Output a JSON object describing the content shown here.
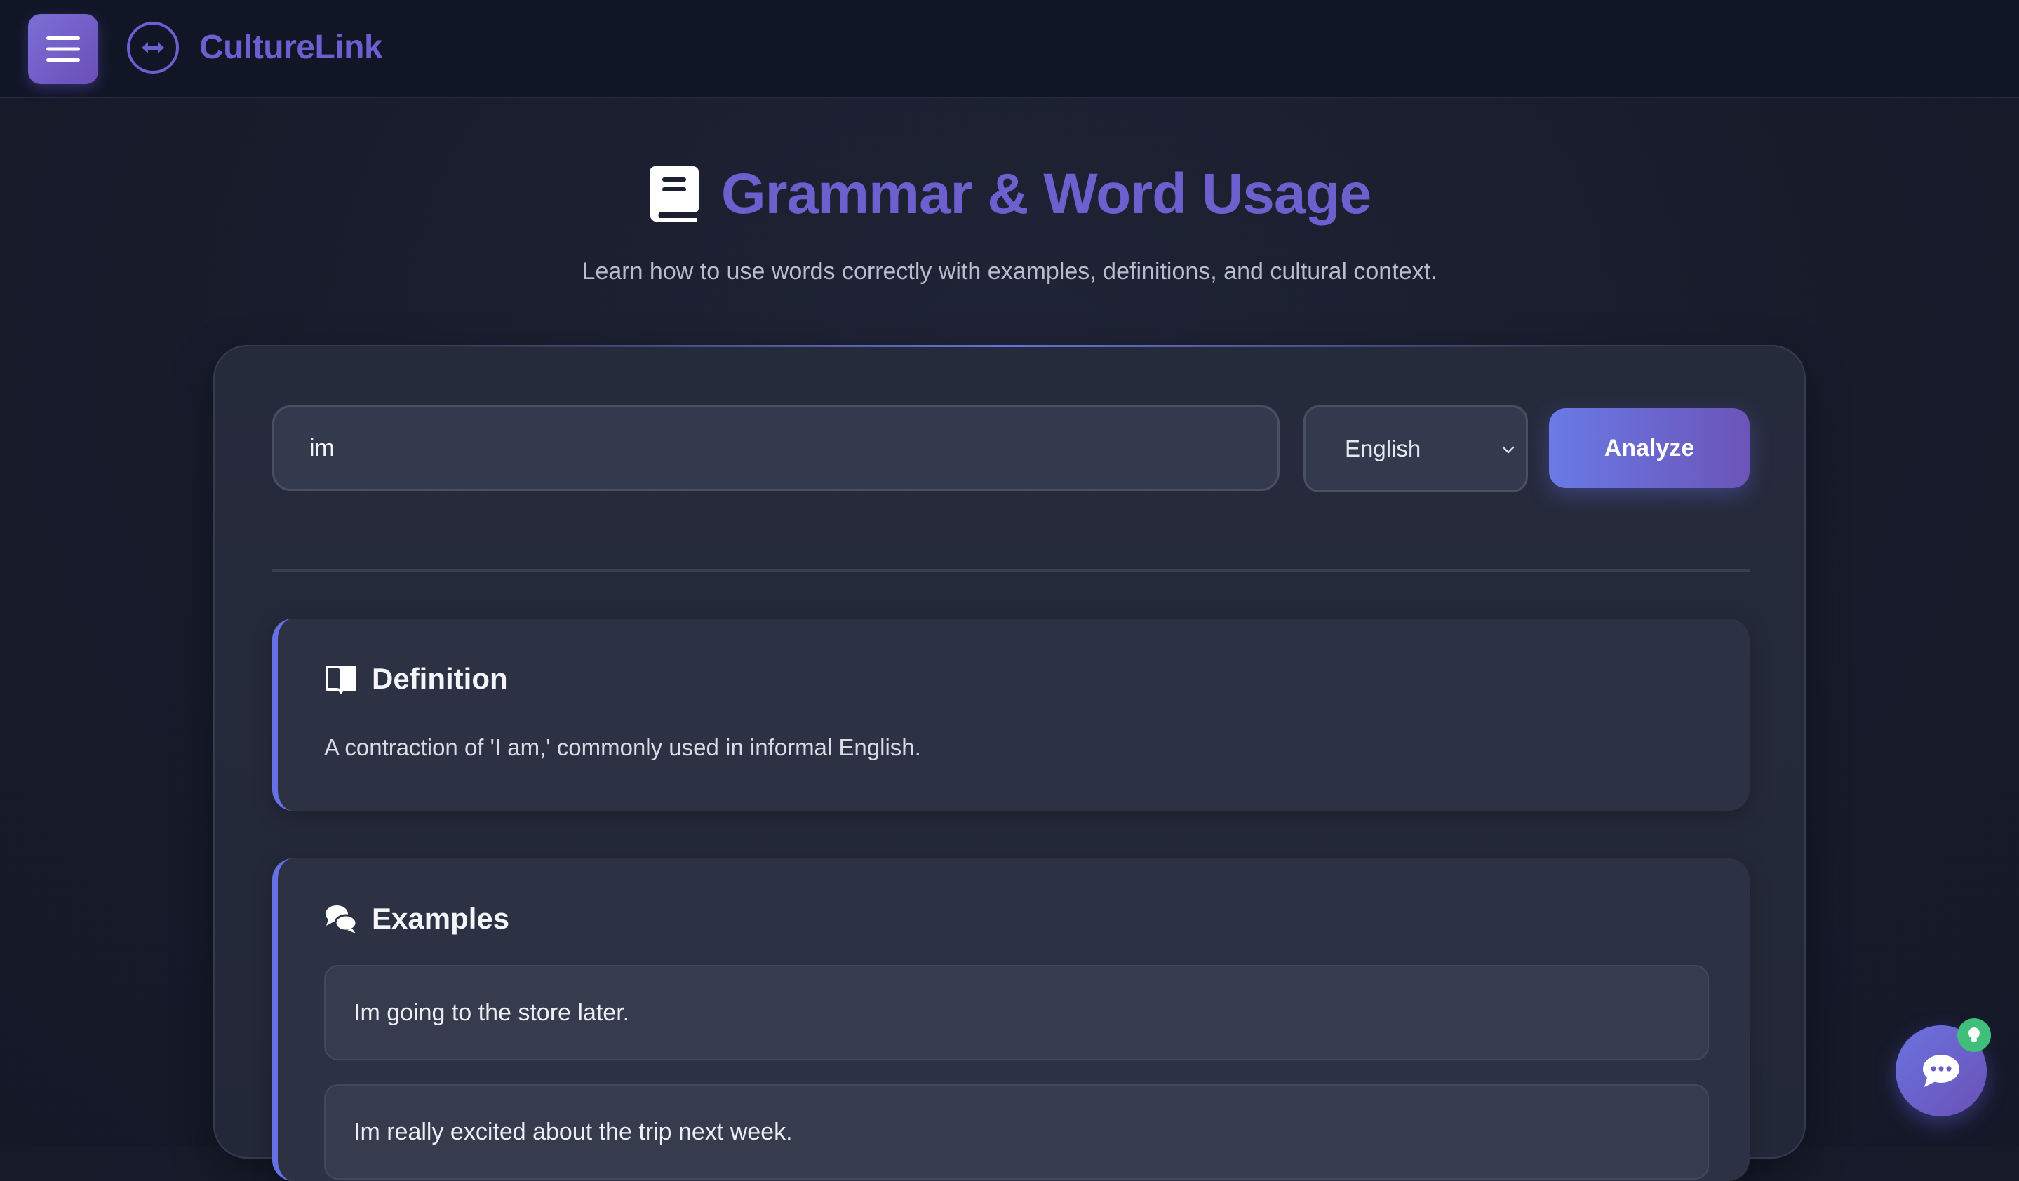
{
  "app": {
    "brand": "CultureLink"
  },
  "header": {
    "title": "Grammar & Word Usage",
    "subtitle": "Learn how to use words correctly with examples, definitions, and cultural context."
  },
  "search": {
    "value": "im",
    "language": "English",
    "analyze_label": "Analyze"
  },
  "definition": {
    "title": "Definition",
    "text": "A contraction of 'I am,' commonly used in informal English."
  },
  "examples": {
    "title": "Examples",
    "items": [
      "Im going to the store later.",
      "Im really excited about the trip next week."
    ]
  },
  "icons": {
    "menu": "hamburger-icon",
    "brand": "translate-arrows-icon",
    "title": "book-icon",
    "definition": "open-book-icon",
    "examples": "comments-icon",
    "chat": "chat-bubble-icon",
    "badge": "lightbulb-icon"
  },
  "colors": {
    "accent": "#6e5fd1",
    "section_border": "#6672e3",
    "badge": "#3fbf7a"
  }
}
